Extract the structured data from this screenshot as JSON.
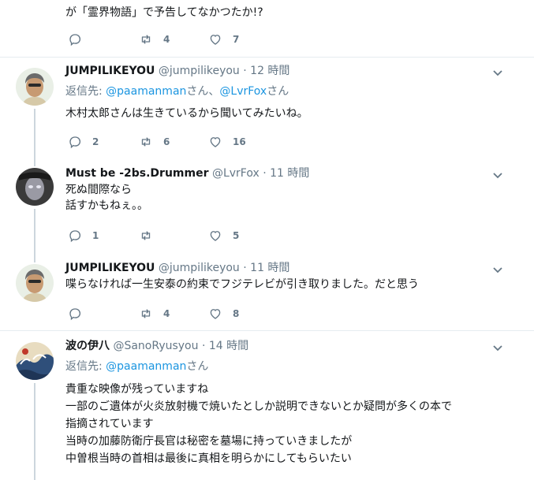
{
  "top_tweet": {
    "text_line": "が「霊界物語」で予告してなかつたか!?",
    "replies": "",
    "retweets": "4",
    "likes": "7"
  },
  "tweets": [
    {
      "display_name": "JUMPILIKEYOU",
      "screen_name": "@jumpilikeyou",
      "dot": "·",
      "time": "12 時間",
      "replying_prefix": "返信先: ",
      "replying_to_1": "@paamanman",
      "replying_sep": "さん、",
      "replying_to_2": "@LvrFox",
      "replying_suffix": "さん",
      "lines": [
        "木村太郎さんは生きているから聞いてみたいね。"
      ],
      "replies": "2",
      "retweets": "6",
      "likes": "16"
    },
    {
      "display_name": "Must be -2bs.Drummer",
      "screen_name": "@LvrFox",
      "dot": "·",
      "time": "11 時間",
      "lines": [
        "死ぬ間際なら",
        "話すかもねぇ。。"
      ],
      "replies": "1",
      "retweets": "",
      "likes": "5"
    },
    {
      "display_name": "JUMPILIKEYOU",
      "screen_name": "@jumpilikeyou",
      "dot": "·",
      "time": "11 時間",
      "lines": [
        "喋らなければ一生安泰の約束でフジテレビが引き取りました。だと思う"
      ],
      "replies": "",
      "retweets": "4",
      "likes": "8"
    },
    {
      "display_name": "波の伊八",
      "screen_name": "@SanoRyusyou",
      "dot": "·",
      "time": "14 時間",
      "replying_prefix": "返信先: ",
      "replying_to_1": "@paamanman",
      "replying_suffix": "さん",
      "lines": [
        "貴重な映像が残っていますね",
        "一部のご遺体が火炎放射機で焼いたとしか説明できないとか疑問が多くの本で",
        "指摘されています",
        "当時の加藤防衛庁長官は秘密を墓場に持っていきましたが",
        "中曽根当時の首相は最後に真相を明らかにしてもらいたい"
      ]
    }
  ],
  "colors": {
    "link": "#1b95e0",
    "muted": "#657786",
    "text": "#14171a",
    "divider": "#e6ecf0",
    "thread_line": "#ccd6dd"
  }
}
